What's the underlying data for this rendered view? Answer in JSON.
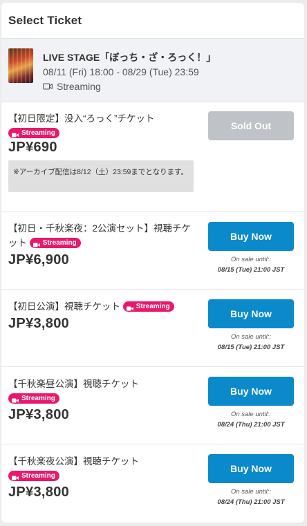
{
  "header": {
    "title": "Select Ticket"
  },
  "event": {
    "title": "LIVE STAGE「ぼっち・ざ・ろっく！」",
    "dates": "08/11 (Fri) 18:00 - 08/29 (Tue) 23:59",
    "stream_label": "Streaming"
  },
  "tickets": [
    {
      "name": "【初日限定】没入“ろっく”チケット",
      "badge": "Streaming",
      "price": "JP¥690",
      "note": "※アーカイブ配信は8/12（土）23:59までとなります。",
      "button": "Sold Out",
      "status": "sold_out"
    },
    {
      "name": "【初日・千秋楽夜：2公演セット】視聴チケット",
      "badge": "Streaming",
      "price": "JP¥6,900",
      "button": "Buy Now",
      "until_label": "On sale until::",
      "until_date": "08/15 (Tue) 21:00 JST"
    },
    {
      "name": "【初日公演】視聴チケット",
      "badge": "Streaming",
      "price": "JP¥3,800",
      "button": "Buy Now",
      "until_label": "On sale until::",
      "until_date": "08/15 (Tue) 21:00 JST"
    },
    {
      "name": "【千秋楽昼公演】視聴チケット",
      "badge": "Streaming",
      "price": "JP¥3,800",
      "button": "Buy Now",
      "until_label": "On sale until::",
      "until_date": "08/24 (Thu) 21:00 JST"
    },
    {
      "name": "【千秋楽夜公演】視聴チケット",
      "badge": "Streaming",
      "price": "JP¥3,800",
      "button": "Buy Now",
      "until_label": "On sale until::",
      "until_date": "08/24 (Thu) 21:00 JST"
    }
  ],
  "colors": {
    "badge": "#e8196b",
    "buy_button": "#0b8acb",
    "sold_out_button": "#bfc2c6"
  }
}
